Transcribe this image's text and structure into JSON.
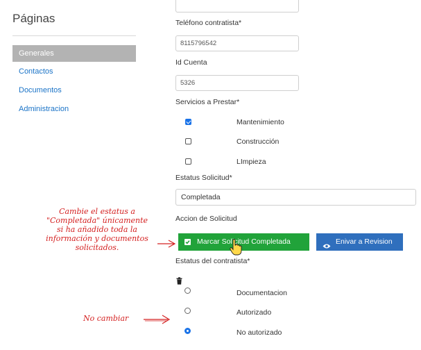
{
  "sidebar": {
    "title": "Páginas",
    "items": [
      {
        "label": "Generales",
        "active": true
      },
      {
        "label": "Contactos",
        "active": false
      },
      {
        "label": "Documentos",
        "active": false
      },
      {
        "label": "Administracion",
        "active": false
      }
    ]
  },
  "form": {
    "telefono_label": "Teléfono contratista*",
    "telefono_value": "8115796542",
    "id_cuenta_label": "Id Cuenta",
    "id_cuenta_value": "5326",
    "servicios_label": "Servicios a Prestar*",
    "servicios": [
      {
        "label": "Mantenimiento",
        "checked": true
      },
      {
        "label": "Construcción",
        "checked": false
      },
      {
        "label": "LImpieza",
        "checked": false
      }
    ],
    "estatus_solicitud_label": "Estatus Solicitud*",
    "estatus_solicitud_value": "Completada",
    "accion_label": "Accion de Solicitud",
    "btn_completar": "Marcar Solicitud Completada",
    "btn_revision": "Enivar a Revision",
    "estatus_contratista_label": "Estatus del contratista*",
    "estatus_contratista": [
      {
        "label": "Documentacion",
        "selected": false
      },
      {
        "label": "Autorizado",
        "selected": false
      },
      {
        "label": "No autorizado",
        "selected": true
      }
    ]
  },
  "annotations": {
    "note_estatus": "Cambie el estatus a\n\"Completada\" únicamente\nsi ha añadido toda la\ninformación y documentos\nsolicitados.",
    "note_no_cambiar": "No cambiar"
  },
  "colors": {
    "accent_blue": "#1a73e8",
    "button_green": "#21a33a",
    "button_blue": "#2f6fbd",
    "sidebar_active": "#b3b3b3",
    "annotation_red": "#d42020"
  },
  "icons": {
    "checkbox_in_button": "check-square-icon",
    "eye": "eye-icon",
    "trash": "trash-icon",
    "cursor": "hand-pointer-icon"
  }
}
